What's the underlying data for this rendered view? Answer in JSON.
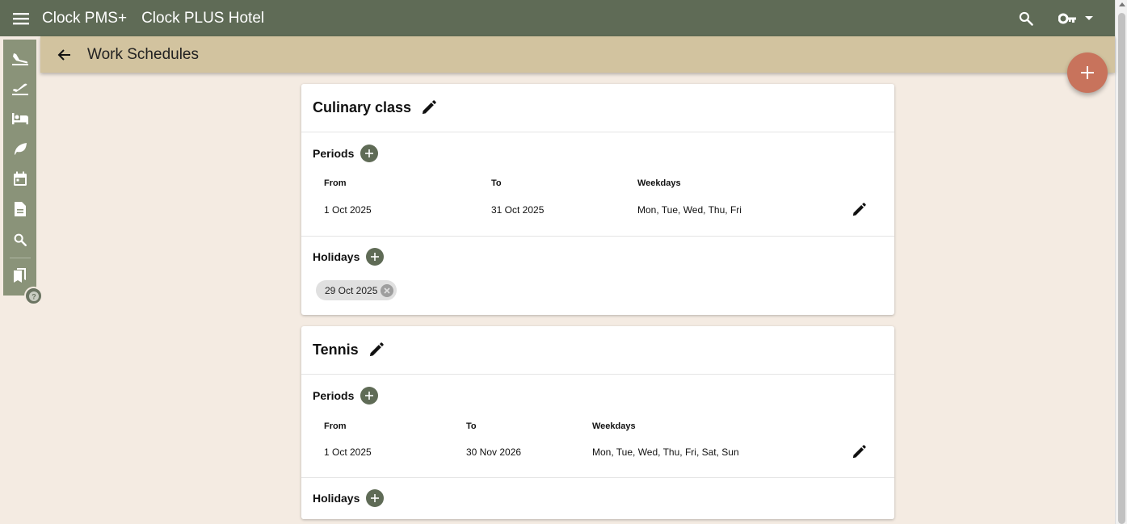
{
  "topbar": {
    "app_name": "Clock PMS+",
    "hotel_name": "Clock PLUS Hotel",
    "icons": [
      "menu-icon",
      "search-icon",
      "key-icon",
      "caret-down-icon"
    ]
  },
  "subbar": {
    "title": "Work Schedules",
    "icons": [
      "arrow-back-icon"
    ]
  },
  "sidebar": {
    "icons": [
      "arrival-icon",
      "departure-icon",
      "bed-icon",
      "leaf-icon",
      "calendar-icon",
      "document-icon",
      "search-icon",
      "bookmarks-icon"
    ],
    "help_icon": "help-icon"
  },
  "fab": {
    "icon": "plus-icon"
  },
  "colors": {
    "topbar": "#5f6b56",
    "subbar": "#d2c39f",
    "sidebar": "#8a9379",
    "background": "#f4ebe2",
    "fab": "#c8735c",
    "add_button": "#5f6b56"
  },
  "schedules": [
    {
      "name": "Culinary class",
      "periods_label": "Periods",
      "columns": [
        "From",
        "To",
        "Weekdays"
      ],
      "periods": [
        {
          "from": "1 Oct 2025",
          "to": "31 Oct 2025",
          "weekdays": "Mon, Tue, Wed, Thu, Fri"
        }
      ],
      "holidays_label": "Holidays",
      "holidays": [
        "29 Oct 2025"
      ]
    },
    {
      "name": "Tennis",
      "periods_label": "Periods",
      "columns": [
        "From",
        "To",
        "Weekdays"
      ],
      "periods": [
        {
          "from": "1 Oct 2025",
          "to": "30 Nov 2026",
          "weekdays": "Mon, Tue, Wed, Thu, Fri, Sat, Sun"
        }
      ],
      "holidays_label": "Holidays",
      "holidays": []
    }
  ]
}
